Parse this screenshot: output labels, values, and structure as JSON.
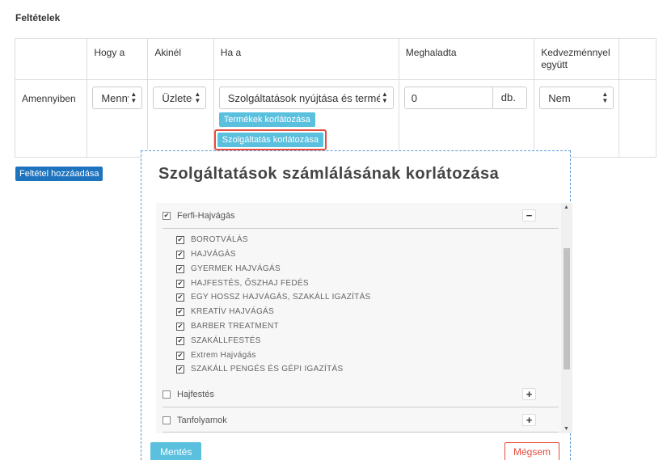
{
  "section_title": "Feltételek",
  "table": {
    "headers": [
      "",
      "Hogy a",
      "Akinél",
      "Ha a",
      "Meghaladta",
      "Kedvezménnyel együtt",
      ""
    ],
    "row_label": "Amennyiben",
    "hogy_a_value": "Mennyi",
    "akinel_value": "Üzleteg",
    "ha_a_value": "Szolgáltatások nyújtása és termé",
    "meghaladta_value": "0",
    "meghaladta_unit": "db.",
    "kedvezmeny_value": "Nem",
    "btn_products": "Termékek korlátozása",
    "btn_services": "Szolgáltatás korlátozása"
  },
  "add_condition_label": "Feltétel hozzáadása",
  "modal": {
    "title": "Szolgáltatások számlálásának korlátozása",
    "groups": [
      {
        "label": "Ferfi-Hajvágás",
        "checked": true,
        "expanded": true,
        "toggle": "−",
        "items": [
          "BOROTVÁLÁS",
          "HAJVÁGÁS",
          "GYERMEK HAJVÁGÁS",
          "HAJFESTÉS, ŐSZHAJ FEDÉS",
          "EGY HOSSZ HAJVÁGÁS, SZAKÁLL IGAZÍTÁS",
          "KREATÍV HAJVÁGÁS",
          "BARBER TREATMENT",
          "SZAKÁLLFESTÉS",
          "Extrem Hajvágás",
          "SZAKÁLL PENGÉS ÉS GÉPI IGAZÍTÁS"
        ]
      },
      {
        "label": "Hajfestés",
        "checked": false,
        "expanded": false,
        "toggle": "+"
      },
      {
        "label": "Tanfolyamok",
        "checked": false,
        "expanded": false,
        "toggle": "+"
      }
    ],
    "save_label": "Mentés",
    "cancel_label": "Mégsem"
  },
  "colors": {
    "accent_cyan": "#5bc0de",
    "primary_blue": "#1e73be",
    "highlight_red": "#e74c3c",
    "modal_border": "#5b9bd5"
  }
}
